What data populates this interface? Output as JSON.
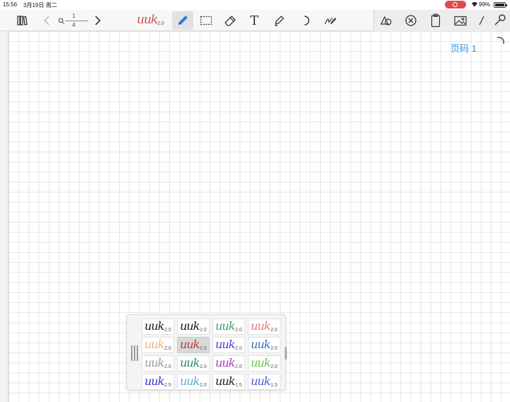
{
  "status": {
    "time": "15:56",
    "date": "3月19日 周二",
    "wifi_icon": "wifi-icon",
    "battery": "99%"
  },
  "toolbar": {
    "page_current": "1",
    "page_total": "4",
    "pen_preview_label": "uuk",
    "pen_preview_size": "2.0",
    "pen_preview_color": "#d24b4b",
    "tools": [
      "library-icon",
      "back-icon",
      "page-search-icon",
      "forward-icon",
      "pen-icon",
      "lasso-select-icon",
      "eraser-icon",
      "text-icon",
      "highlighter-icon",
      "undo-icon",
      "signature-icon",
      "shape-icon",
      "cancel-icon",
      "clipboard-icon",
      "image-icon",
      "ruler-icon",
      "settings-wrench-icon"
    ],
    "active_tool": "pen-icon"
  },
  "canvas": {
    "page_label": "页码 1",
    "page_label_color": "#3a8fd9"
  },
  "palette": {
    "selected_index": 5,
    "pens": [
      {
        "label": "uuk",
        "size": "2.5",
        "color": "#1a1a1a"
      },
      {
        "label": "uuk",
        "size": "2.0",
        "color": "#1a1a1a"
      },
      {
        "label": "uuk",
        "size": "2.0",
        "color": "#3fa35e"
      },
      {
        "label": "uuk",
        "size": "2.0",
        "color": "#e07a7a"
      },
      {
        "label": "uuk",
        "size": "2.0",
        "color": "#f0b27a"
      },
      {
        "label": "uuk",
        "size": "2.0",
        "color": "#c0393b"
      },
      {
        "label": "uuk",
        "size": "2.0",
        "color": "#4a3fd0"
      },
      {
        "label": "uuk",
        "size": "2.0",
        "color": "#3a6fb5"
      },
      {
        "label": "uuk",
        "size": "2.0",
        "color": "#9a9a9a"
      },
      {
        "label": "uuk",
        "size": "2.0",
        "color": "#2f8a5a"
      },
      {
        "label": "uuk",
        "size": "2.0",
        "color": "#b03ab0"
      },
      {
        "label": "uuk",
        "size": "2.0",
        "color": "#6cbf4a"
      },
      {
        "label": "uuk",
        "size": "2.5",
        "color": "#3535c8"
      },
      {
        "label": "uuk",
        "size": "2.0",
        "color": "#5aaee0"
      },
      {
        "label": "uuk",
        "size": "1.5",
        "color": "#1a1a1a"
      },
      {
        "label": "uuk",
        "size": "1.5",
        "color": "#4a5ad0"
      }
    ]
  }
}
